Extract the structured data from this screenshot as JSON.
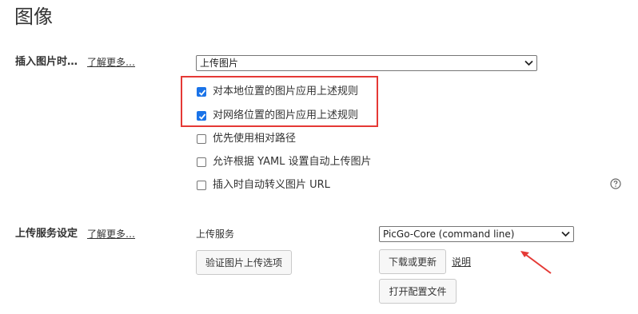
{
  "page": {
    "title": "图像"
  },
  "insert_image": {
    "label": "插入图片时…",
    "learn_more": "了解更多…",
    "select_value": "上传图片",
    "options": [
      {
        "label": "对本地位置的图片应用上述规则",
        "checked": true
      },
      {
        "label": "对网络位置的图片应用上述规则",
        "checked": true
      },
      {
        "label": "优先使用相对路径",
        "checked": false
      },
      {
        "label": "允许根据 YAML 设置自动上传图片",
        "checked": false
      },
      {
        "label": "插入时自动转义图片 URL",
        "checked": false
      }
    ],
    "help_icon": "question-circle-icon"
  },
  "upload_service": {
    "label": "上传服务设定",
    "learn_more": "了解更多…",
    "field_label": "上传服务",
    "select_value": "PicGo-Core (command line)",
    "verify_button": "验证图片上传选项",
    "download_button": "下载或更新",
    "explain_link": "说明",
    "open_config_button": "打开配置文件"
  },
  "annotations": {
    "highlight_color": "#e53935",
    "arrow_color": "#e53935"
  },
  "colors": {
    "checkbox_checked": "#1a73e8"
  }
}
